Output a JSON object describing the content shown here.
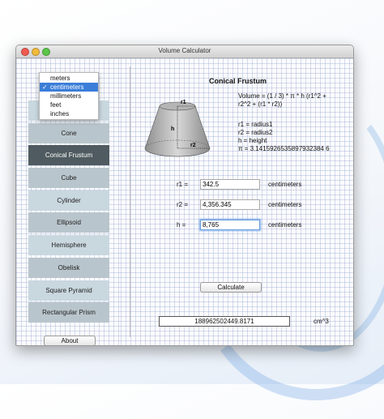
{
  "window": {
    "title": "Volume Calculator"
  },
  "units": {
    "options": [
      "meters",
      "centimeters",
      "millimeters",
      "feet",
      "inches"
    ],
    "selected_index": 1
  },
  "sidebar": {
    "shapes": [
      "Cone",
      "Conical Frustum",
      "Cube",
      "Cylinder",
      "Ellipsoid",
      "Hemisphere",
      "Obelisk",
      "Square Pyramid",
      "Rectangular Prism"
    ],
    "selected": "Conical Frustum",
    "about_label": "About"
  },
  "main": {
    "heading": "Conical Frustum",
    "formula_line1": "Volume = (1 / 3) * π * h (r1^2 +",
    "formula_line2": "r2^2 + (r1 * r2))",
    "legend": [
      "r1 = radius1",
      "r2 = radius2",
      "h = height",
      "π = 3.1415926535897932384 6"
    ],
    "diagram_labels": {
      "r1": "r1",
      "h": "h",
      "r2": "r2"
    },
    "inputs": [
      {
        "label": "r1 =",
        "value": "342.5",
        "unit": "centimeters"
      },
      {
        "label": "r2 =",
        "value": "4,356.345",
        "unit": "centimeters"
      },
      {
        "label": "h =",
        "value": "8,765",
        "unit": "centimeters"
      }
    ],
    "calculate_label": "Calculate",
    "result_value": "188962502449.8171",
    "result_unit": "cm^3"
  },
  "colors": {
    "selected_shape": "#4f5b60",
    "shape_button": "#b9c5cc",
    "menu_highlight": "#3b7ed9"
  }
}
